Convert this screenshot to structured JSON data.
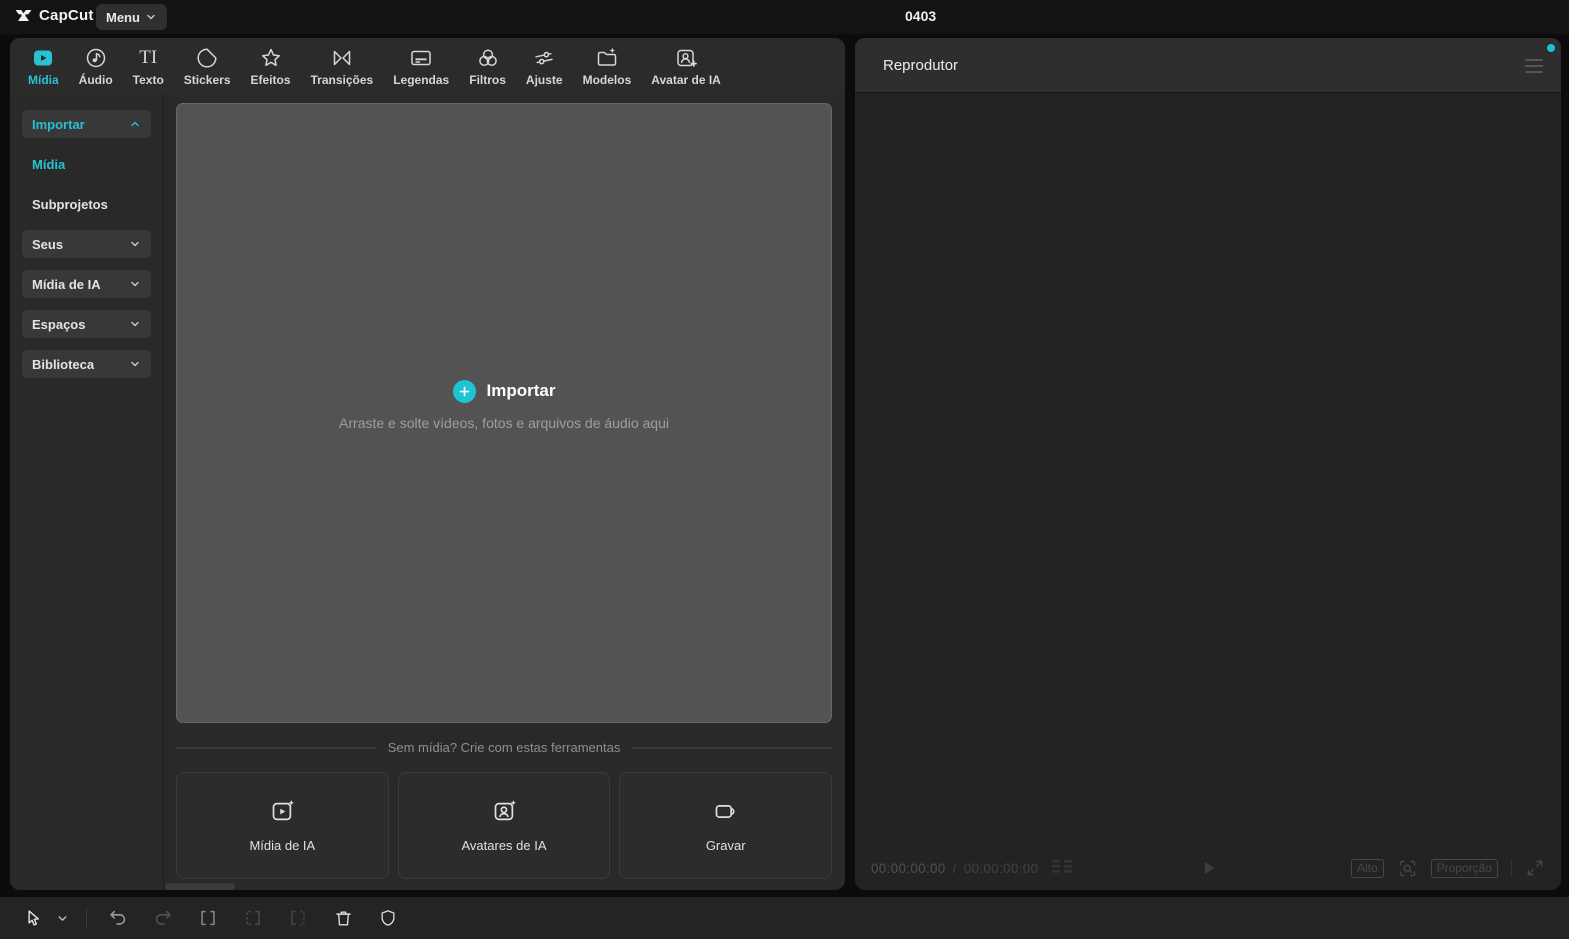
{
  "colors": {
    "accent": "#27c2d4",
    "notification_dot": "#17c2d2",
    "dropzone_bg": "#535353"
  },
  "topbar": {
    "logo_text": "CapCut",
    "menu_label": "Menu",
    "project_title": "0403"
  },
  "tabs": [
    {
      "label": "Mídia",
      "icon": "media-play-icon",
      "active": true
    },
    {
      "label": "Áudio",
      "icon": "audio-note-icon"
    },
    {
      "label": "Texto",
      "icon": "text-serif-icon"
    },
    {
      "label": "Stickers",
      "icon": "sticker-peel-icon"
    },
    {
      "label": "Efeitos",
      "icon": "effects-star-icon"
    },
    {
      "label": "Transições",
      "icon": "transitions-bowtie-icon"
    },
    {
      "label": "Legendas",
      "icon": "captions-card-icon"
    },
    {
      "label": "Filtros",
      "icon": "filters-circles-icon"
    },
    {
      "label": "Ajuste",
      "icon": "adjust-sliders-icon"
    },
    {
      "label": "Modelos",
      "icon": "templates-folder-icon"
    },
    {
      "label": "Avatar de IA",
      "icon": "ai-avatar-frame-icon"
    }
  ],
  "icons": {
    "texto_glyph": "TI"
  },
  "sidebar": {
    "items": [
      {
        "label": "Importar",
        "state": "expanded",
        "accent": true
      },
      {
        "label": "Mídia",
        "accent": true
      },
      {
        "label": "Subprojetos"
      },
      {
        "label": "Seus",
        "state": "collapsed"
      },
      {
        "label": "Mídia de IA",
        "state": "collapsed"
      },
      {
        "label": "Espaços",
        "state": "collapsed"
      },
      {
        "label": "Biblioteca",
        "state": "collapsed"
      }
    ]
  },
  "import_panel": {
    "import_label": "Importar",
    "dropzone_hint": "Arraste e solte vídeos, fotos e arquivos de áudio aqui",
    "tools_divider_label": "Sem mídia? Crie com estas ferramentas",
    "tool_cards": [
      {
        "label": "Mídia de IA",
        "icon": "ai-media-icon"
      },
      {
        "label": "Avatares de IA",
        "icon": "ai-avatars-icon"
      },
      {
        "label": "Gravar",
        "icon": "record-camera-icon"
      }
    ]
  },
  "player": {
    "title": "Reprodutor",
    "current_time": "00:00:00:00",
    "time_separator": "/",
    "total_time": "00:00:00:00",
    "quality_label": "Alto",
    "ratio_label": "Proporção"
  }
}
